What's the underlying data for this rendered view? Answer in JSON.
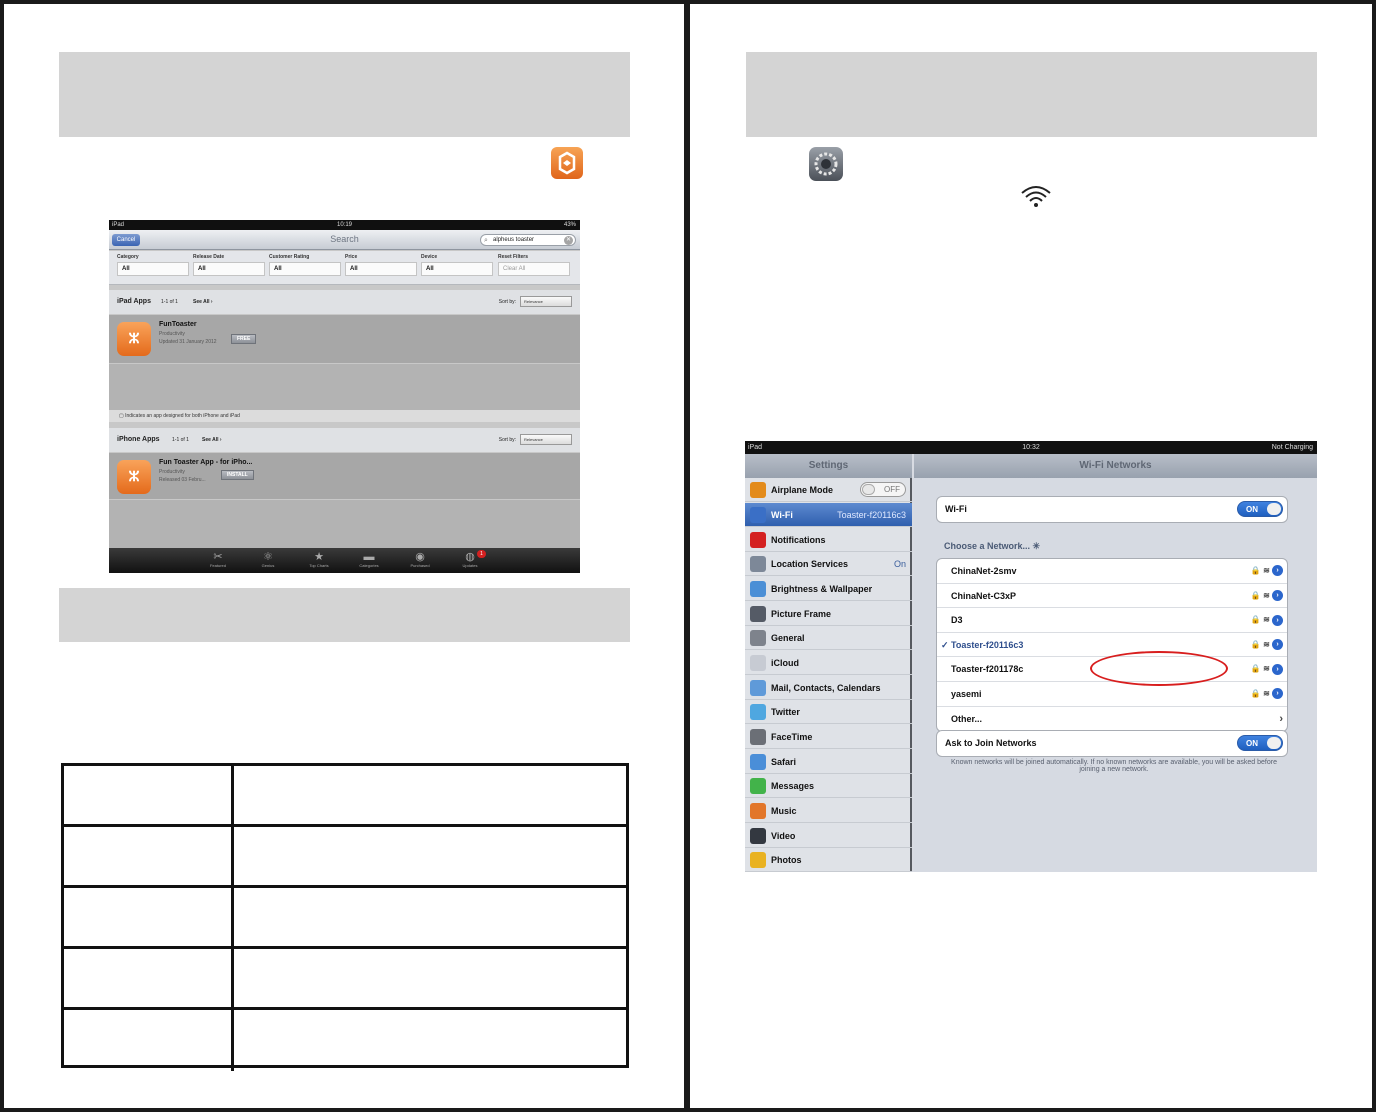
{
  "store": {
    "status": {
      "carrier": "iPad",
      "time": "10:19",
      "battery": "43%"
    },
    "nav": {
      "cancel": "Cancel",
      "title": "Search",
      "query": "alpheus toaster"
    },
    "filters": [
      {
        "label": "Category",
        "value": "All"
      },
      {
        "label": "Release Date",
        "value": "All"
      },
      {
        "label": "Customer Rating",
        "value": "All"
      },
      {
        "label": "Price",
        "value": "All"
      },
      {
        "label": "Device",
        "value": "All"
      },
      {
        "label": "Reset Filters",
        "value": "Clear All"
      }
    ],
    "ipad_section": {
      "title": "iPad Apps",
      "count": "1-1 of 1",
      "see_all": "See All ›",
      "sort_label": "Sort by:",
      "sort_value": "Relevance"
    },
    "ipad_app": {
      "name": "FunToaster",
      "category": "Productivity",
      "updated": "Updated 31 January 2012",
      "button": "FREE"
    },
    "note": "Indicates an app designed for both iPhone and iPad",
    "iphone_section": {
      "title": "iPhone Apps",
      "count": "1-1 of 1",
      "see_all": "See All ›",
      "sort_label": "Sort by:",
      "sort_value": "Relevance"
    },
    "iphone_app": {
      "name": "Fun Toaster App - for iPho...",
      "category": "Productivity",
      "updated": "Released 03 Febru...",
      "button": "INSTALL"
    },
    "tabs": [
      "Featured",
      "Genius",
      "Top Charts",
      "Categories",
      "Purchased",
      "Updates"
    ],
    "updates_badge": "1"
  },
  "settings": {
    "status": {
      "carrier": "iPad",
      "time": "10:32",
      "battery": "Not Charging"
    },
    "sidebar_title": "Settings",
    "sidebar": [
      {
        "label": "Airplane Mode",
        "value": "OFF",
        "color": "#e38b1b"
      },
      {
        "label": "Wi-Fi",
        "value": "Toaster-f20116c3",
        "color": "#3a6fc6"
      },
      {
        "label": "Notifications",
        "value": "",
        "color": "#d42020"
      },
      {
        "label": "Location Services",
        "value": "On",
        "color": "#7d8898"
      },
      {
        "label": "Brightness & Wallpaper",
        "value": "",
        "color": "#4b8fd6"
      },
      {
        "label": "Picture Frame",
        "value": "",
        "color": "#555b66"
      },
      {
        "label": "General",
        "value": "",
        "color": "#7e838c"
      },
      {
        "label": "iCloud",
        "value": "",
        "color": "#c7cbd3"
      },
      {
        "label": "Mail, Contacts, Calendars",
        "value": "",
        "color": "#5f9ad9"
      },
      {
        "label": "Twitter",
        "value": "",
        "color": "#4fa7e0"
      },
      {
        "label": "FaceTime",
        "value": "",
        "color": "#6b6f76"
      },
      {
        "label": "Safari",
        "value": "",
        "color": "#4a8ed8"
      },
      {
        "label": "Messages",
        "value": "",
        "color": "#42b34a"
      },
      {
        "label": "Music",
        "value": "",
        "color": "#e2762a"
      },
      {
        "label": "Video",
        "value": "",
        "color": "#333840"
      },
      {
        "label": "Photos",
        "value": "",
        "color": "#e9b221"
      }
    ],
    "main_title": "Wi-Fi Networks",
    "wifi_label": "Wi-Fi",
    "wifi_toggle": "ON",
    "choose_label": "Choose a Network...",
    "networks": [
      {
        "name": "ChinaNet-2smv",
        "current": false
      },
      {
        "name": "ChinaNet-C3xP",
        "current": false
      },
      {
        "name": "D3",
        "current": false
      },
      {
        "name": "Toaster-f20116c3",
        "current": true
      },
      {
        "name": "Toaster-f201178c",
        "current": false
      },
      {
        "name": "yasemi",
        "current": false
      }
    ],
    "other_label": "Other...",
    "ask_label": "Ask to Join Networks",
    "ask_toggle": "ON",
    "footer": "Known networks will be joined automatically. If no known networks are available, you will be asked before joining a new network."
  }
}
